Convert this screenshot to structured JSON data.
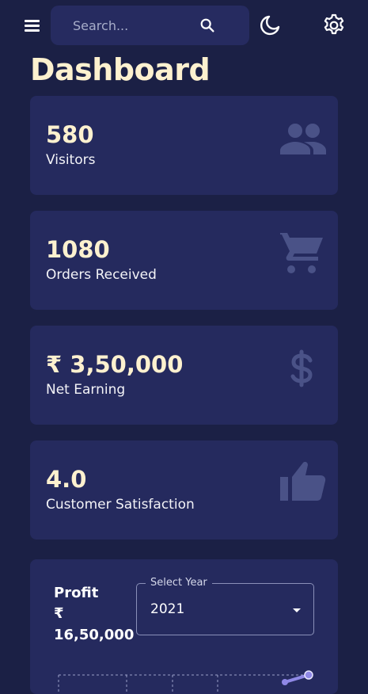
{
  "header": {
    "search_placeholder": "Search...",
    "icons": [
      "menu-icon",
      "search-icon",
      "moon-icon",
      "gear-icon"
    ]
  },
  "page": {
    "title": "Dashboard"
  },
  "cards": [
    {
      "value": "580",
      "label": "Visitors",
      "icon": "people-icon"
    },
    {
      "value": "1080",
      "label": "Orders Received",
      "icon": "cart-icon"
    },
    {
      "value": "₹ 3,50,000",
      "label": "Net Earning",
      "icon": "dollar-icon"
    },
    {
      "value": "4.0",
      "label": "Customer Satisfaction",
      "icon": "thumbs-up-icon"
    }
  ],
  "profit": {
    "title": "Profit",
    "currency": "₹",
    "value": "16,50,000",
    "select_label": "Select Year",
    "select_value": "2021"
  },
  "colors": {
    "background": "#1b2045",
    "card": "#252a5e",
    "accent_text": "#fdf1cf",
    "icon_muted": "#4a5287",
    "chart_line": "#8f88e6"
  }
}
